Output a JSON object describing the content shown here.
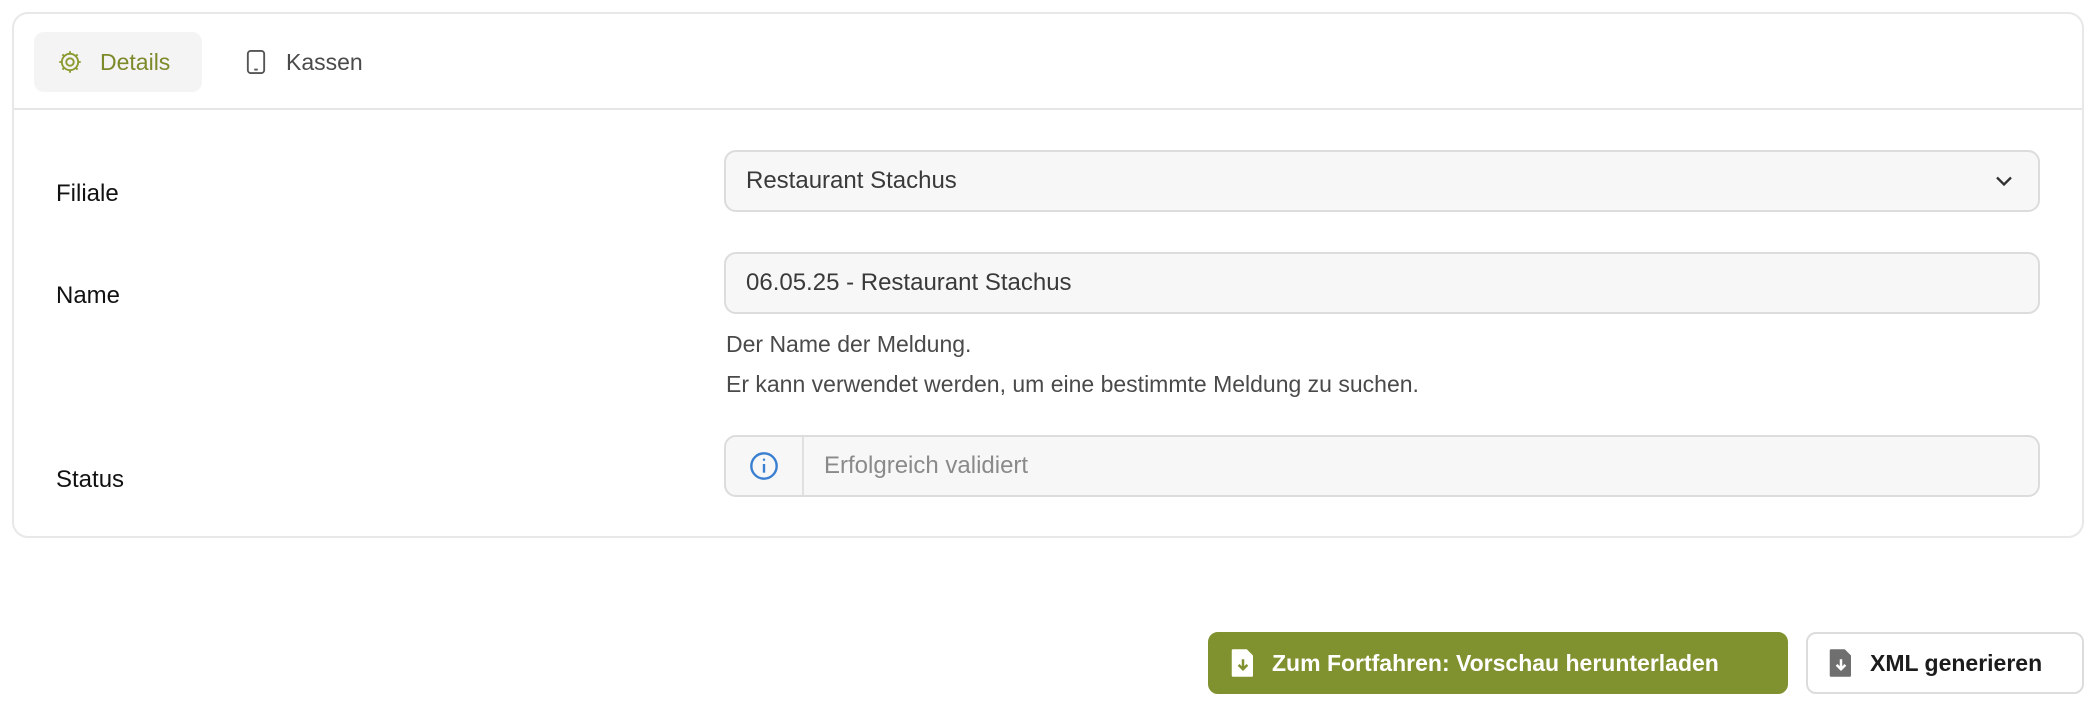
{
  "tabs": [
    {
      "label": "Details",
      "icon": "gear-icon",
      "active": true
    },
    {
      "label": "Kassen",
      "icon": "tablet-icon",
      "active": false
    }
  ],
  "form": {
    "filiale": {
      "label": "Filiale",
      "value": "Restaurant Stachus"
    },
    "name": {
      "label": "Name",
      "value": "06.05.25 - Restaurant Stachus",
      "hint_line1": "Der Name der Meldung.",
      "hint_line2": "Er kann verwendet werden, um eine bestimmte Meldung zu suchen."
    },
    "status": {
      "label": "Status",
      "value": "Erfolgreich validiert"
    }
  },
  "actions": {
    "preview_label": "Zum Fortfahren: Vorschau herunterladen",
    "xml_label": "XML generieren"
  },
  "colors": {
    "accent": "#7f922f",
    "info": "#3b7fd1"
  }
}
